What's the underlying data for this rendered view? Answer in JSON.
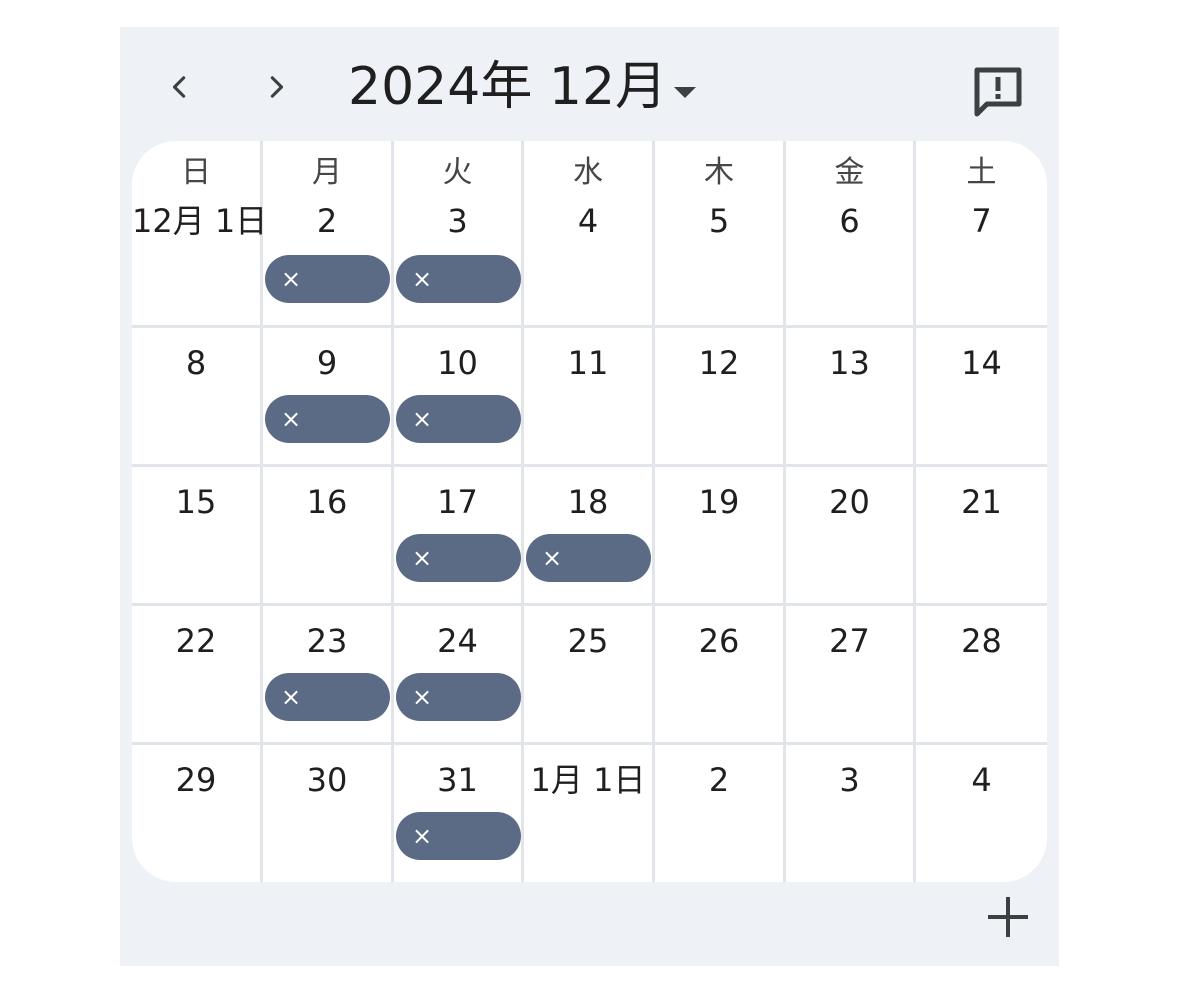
{
  "header": {
    "title": "2024年 12月",
    "prev_icon": "chevron-left-icon",
    "next_icon": "chevron-right-icon",
    "dropdown_icon": "caret-down-icon",
    "feedback_icon": "feedback-icon"
  },
  "weekdays": [
    "日",
    "月",
    "火",
    "水",
    "木",
    "金",
    "土"
  ],
  "weeks": [
    [
      {
        "label": "12月 1日",
        "event": false
      },
      {
        "label": "2",
        "event": true
      },
      {
        "label": "3",
        "event": true
      },
      {
        "label": "4",
        "event": false
      },
      {
        "label": "5",
        "event": false
      },
      {
        "label": "6",
        "event": false
      },
      {
        "label": "7",
        "event": false
      }
    ],
    [
      {
        "label": "8",
        "event": false
      },
      {
        "label": "9",
        "event": true
      },
      {
        "label": "10",
        "event": true
      },
      {
        "label": "11",
        "event": false
      },
      {
        "label": "12",
        "event": false
      },
      {
        "label": "13",
        "event": false
      },
      {
        "label": "14",
        "event": false
      }
    ],
    [
      {
        "label": "15",
        "event": false
      },
      {
        "label": "16",
        "event": false
      },
      {
        "label": "17",
        "event": true
      },
      {
        "label": "18",
        "event": true
      },
      {
        "label": "19",
        "event": false
      },
      {
        "label": "20",
        "event": false
      },
      {
        "label": "21",
        "event": false
      }
    ],
    [
      {
        "label": "22",
        "event": false
      },
      {
        "label": "23",
        "event": true
      },
      {
        "label": "24",
        "event": true
      },
      {
        "label": "25",
        "event": false
      },
      {
        "label": "26",
        "event": false
      },
      {
        "label": "27",
        "event": false
      },
      {
        "label": "28",
        "event": false
      }
    ],
    [
      {
        "label": "29",
        "event": false
      },
      {
        "label": "30",
        "event": false
      },
      {
        "label": "31",
        "event": true
      },
      {
        "label": "1月 1日",
        "event": false
      },
      {
        "label": "2",
        "event": false
      },
      {
        "label": "3",
        "event": false
      },
      {
        "label": "4",
        "event": false
      }
    ]
  ],
  "event_chip": {
    "icon": "close-icon",
    "glyph": "×",
    "color": "#5b6a85"
  },
  "footer": {
    "add_icon": "plus-icon"
  },
  "colors": {
    "background": "#eef2f7",
    "grid": "#ffffff",
    "divider": "#e1e5ea",
    "text": "#1f1f1f"
  }
}
